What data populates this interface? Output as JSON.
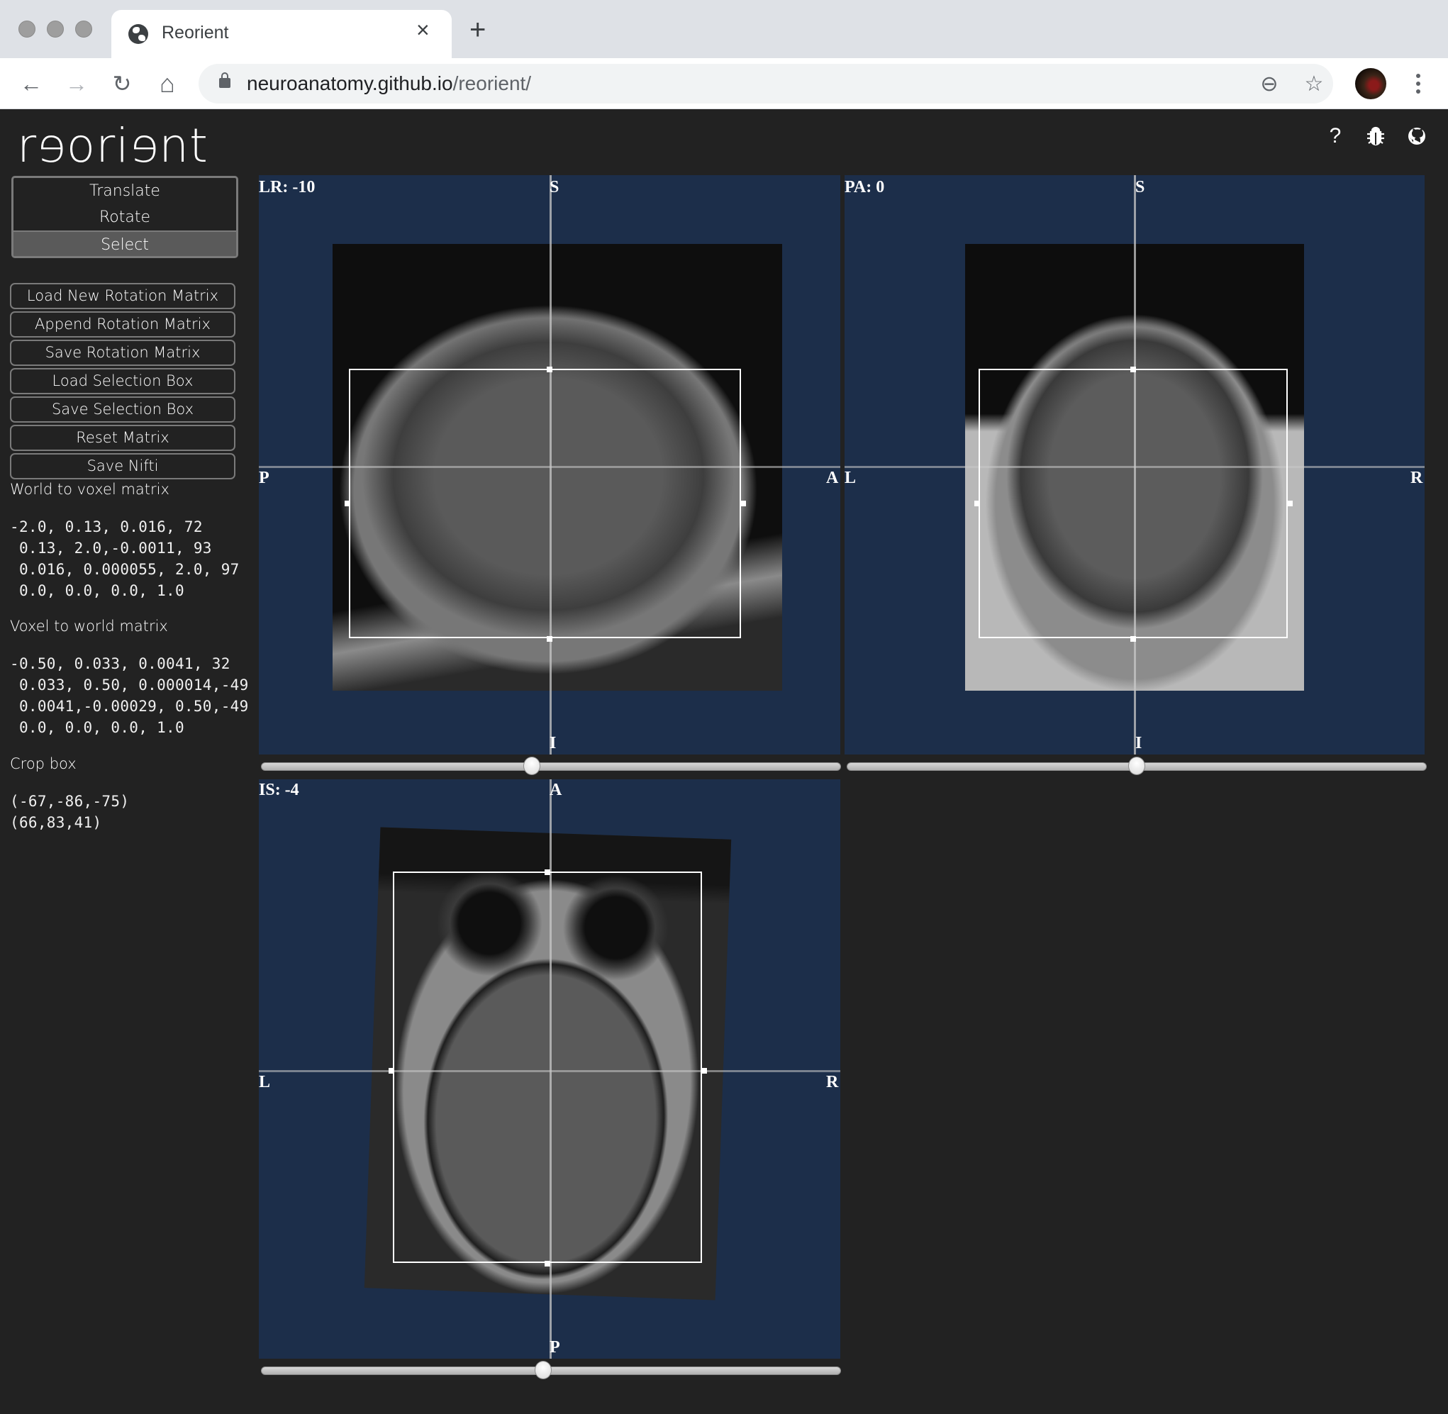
{
  "browser": {
    "tab_title": "Reorient",
    "tab_close_glyph": "×",
    "new_tab_glyph": "+",
    "url_domain": "neuroanatomy.github.io",
    "url_path": "/reorient/",
    "nav": {
      "back": "←",
      "forward": "→",
      "reload": "↻",
      "home": "⌂"
    },
    "omnibox_icons": {
      "zoom": "⊖",
      "bookmark": "☆"
    }
  },
  "app": {
    "logo": {
      "pre": "r",
      "e1": "e",
      "mid": "ori",
      "e2": "e",
      "post": "nt"
    },
    "header_icons": {
      "help": "?",
      "bug": "✱",
      "github": "●"
    },
    "modes": [
      {
        "label": "Translate",
        "active": false
      },
      {
        "label": "Rotate",
        "active": false
      },
      {
        "label": "Select",
        "active": true
      }
    ],
    "actions": [
      "Load New Rotation Matrix",
      "Append Rotation Matrix",
      "Save Rotation Matrix",
      "Load Selection Box",
      "Save Selection Box",
      "Reset Matrix",
      "Save Nifti"
    ],
    "world_to_voxel": {
      "label": "World to voxel matrix",
      "rows": [
        "-2.0, 0.13, 0.016, 72",
        " 0.13, 2.0,-0.0011, 93",
        " 0.016, 0.000055, 2.0, 97",
        " 0.0, 0.0, 0.0, 1.0"
      ]
    },
    "voxel_to_world": {
      "label": "Voxel to world matrix",
      "rows": [
        "-0.50, 0.033, 0.0041, 32",
        " 0.033, 0.50, 0.000014,-49",
        " 0.0041,-0.00029, 0.50,-49",
        " 0.0, 0.0, 0.0, 1.0"
      ]
    },
    "crop_box": {
      "label": "Crop box",
      "min": "(-67,-86,-75)",
      "max": "(66,83,41)"
    }
  },
  "views": {
    "sagittal": {
      "slice_label": "LR: -10",
      "top": "S",
      "bottom": "I",
      "left": "P",
      "right": "A",
      "slider_fraction": 0.466
    },
    "coronal": {
      "slice_label": "PA: 0",
      "top": "S",
      "bottom": "I",
      "left": "L",
      "right": "R",
      "slider_fraction": 0.5
    },
    "axial": {
      "slice_label": "IS: -4",
      "top": "A",
      "bottom": "P",
      "left": "L",
      "right": "R",
      "slider_fraction": 0.486
    }
  },
  "colors": {
    "view_background": "#1c2e4a",
    "app_background": "#222222",
    "active_mode": "#5a5a5a"
  }
}
